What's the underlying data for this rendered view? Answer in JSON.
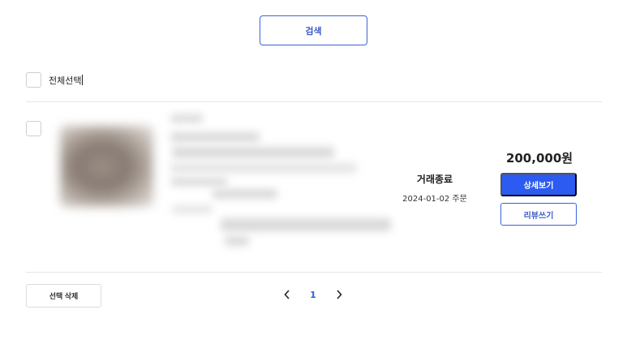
{
  "search": {
    "label": "검색"
  },
  "select_all": {
    "label": "전체선택"
  },
  "orders": [
    {
      "status": "거래종료",
      "order_date": "2024-01-02 주문",
      "price": "200,000원",
      "detail_label": "상세보기",
      "review_label": "리뷰쓰기"
    }
  ],
  "footer": {
    "delete_label": "선택 삭제"
  },
  "pagination": {
    "current_page": "1",
    "prev_icon": "chevron-left-icon",
    "next_icon": "chevron-right-icon"
  },
  "colors": {
    "accent": "#2b5bf0",
    "outline": "#3b64d8",
    "divider": "#e6e6e6"
  }
}
